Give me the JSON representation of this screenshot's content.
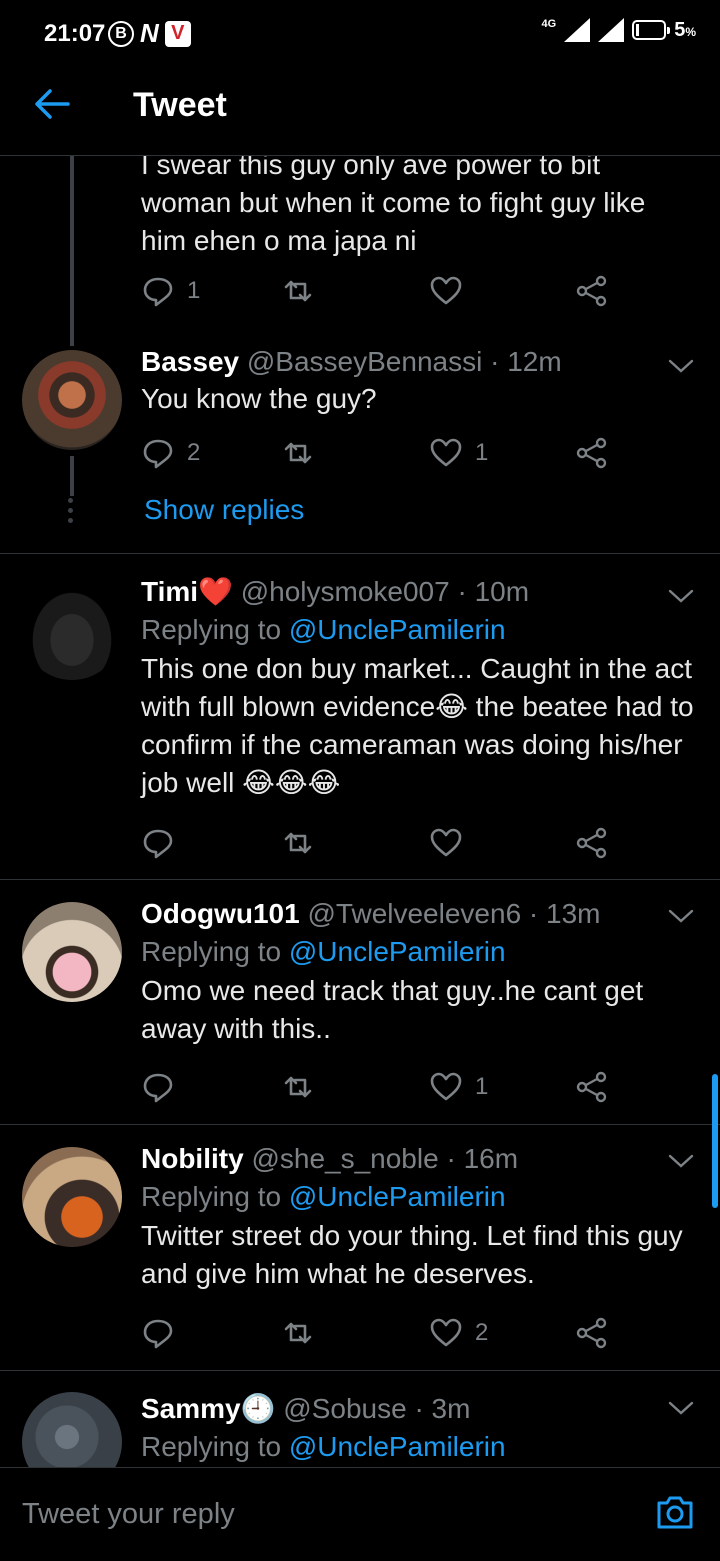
{
  "status_bar": {
    "time": "21:07",
    "badge": "B",
    "network": "4G",
    "battery": "5",
    "battery_unit": "%"
  },
  "header": {
    "title": "Tweet"
  },
  "colors": {
    "accent": "#1d9bf0",
    "muted": "#7d8287",
    "background": "#000000",
    "heart": "#e0245e"
  },
  "partial_tweet": {
    "text": "I swear this guy only ave power to bit woman but when it come to fight guy like him ehen o ma japa ni",
    "replies": "1",
    "retweets": "",
    "likes": ""
  },
  "thread_reply": {
    "name": "Bassey",
    "handle": "@BasseyBennassi",
    "time": "· 12m",
    "text": "You know the guy?",
    "replies": "2",
    "retweets": "",
    "likes": "1",
    "show_replies": "Show replies"
  },
  "tweets": [
    {
      "name": "Timi",
      "name_emoji": "❤️",
      "handle": "@holysmoke007",
      "time": "· 10m",
      "replying_prefix": "Replying to",
      "replying_to": "@UnclePamilerin",
      "text": "This one don buy market... Caught in the act with full blown evidence😂 the beatee had to confirm if the cameraman was doing his/her job well 😂😂😂",
      "replies": "",
      "retweets": "",
      "likes": ""
    },
    {
      "name": "Odogwu101",
      "name_emoji": "",
      "handle": "@Twelveeleven6",
      "time": "· 13m",
      "replying_prefix": "Replying to",
      "replying_to": "@UnclePamilerin",
      "text": "Omo we need track that guy..he cant get away with  this..",
      "replies": "",
      "retweets": "",
      "likes": "1"
    },
    {
      "name": "Nobility",
      "name_emoji": "",
      "handle": "@she_s_noble",
      "time": "· 16m",
      "replying_prefix": "Replying to",
      "replying_to": "@UnclePamilerin",
      "text": "Twitter street do your thing. Let find this guy and give him what he deserves.",
      "replies": "",
      "retweets": "",
      "likes": "2"
    },
    {
      "name": "Sammy",
      "name_emoji": "🕘",
      "handle": "@Sobuse",
      "time": "· 3m",
      "replying_prefix": "Replying to",
      "replying_to": "@UnclePamilerin",
      "text": "",
      "replies": "",
      "retweets": "",
      "likes": ""
    }
  ],
  "reply_bar": {
    "placeholder": "Tweet your reply"
  }
}
